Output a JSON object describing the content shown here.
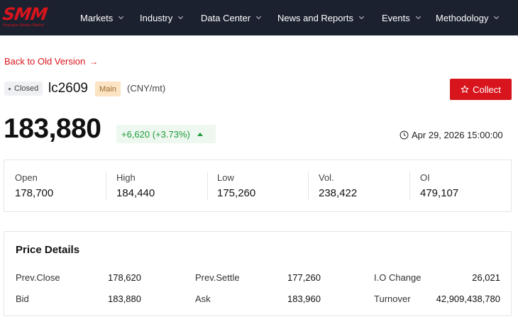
{
  "brand": {
    "logo_text": "SMM",
    "logo_sub": "Shanghai Metals Market",
    "color": "#d8141c"
  },
  "nav": {
    "items": [
      {
        "label": "Markets"
      },
      {
        "label": "Industry"
      },
      {
        "label": "Data Center"
      },
      {
        "label": "News and Reports"
      },
      {
        "label": "Events"
      },
      {
        "label": "Methodology"
      }
    ]
  },
  "back_link": {
    "label": "Back to Old Version",
    "arrow": "→"
  },
  "instrument": {
    "status": "Closed",
    "symbol": "lc2609",
    "contract_tag": "Main",
    "unit": "(CNY/mt)"
  },
  "collect_button": {
    "label": "Collect",
    "icon": "star-icon"
  },
  "quote": {
    "price": "183,880",
    "change": "+6,620 (+3.73%)",
    "direction": "up",
    "up_color": "#1e9b3a",
    "timestamp": "Apr 29, 2026 15:00:00"
  },
  "stats": [
    {
      "label": "Open",
      "value": "178,700"
    },
    {
      "label": "High",
      "value": "184,440"
    },
    {
      "label": "Low",
      "value": "175,260"
    },
    {
      "label": "Vol.",
      "value": "238,422"
    },
    {
      "label": "OI",
      "value": "479,107"
    }
  ],
  "details": {
    "title": "Price Details",
    "rows": [
      [
        {
          "label": "Prev.Close",
          "value": "178,620"
        },
        {
          "label": "Prev.Settle",
          "value": "177,260"
        },
        {
          "label": "I.O Change",
          "value": "26,021"
        }
      ],
      [
        {
          "label": "Bid",
          "value": "183,880"
        },
        {
          "label": "Ask",
          "value": "183,960"
        },
        {
          "label": "Turnover",
          "value": "42,909,438,780"
        }
      ]
    ]
  }
}
